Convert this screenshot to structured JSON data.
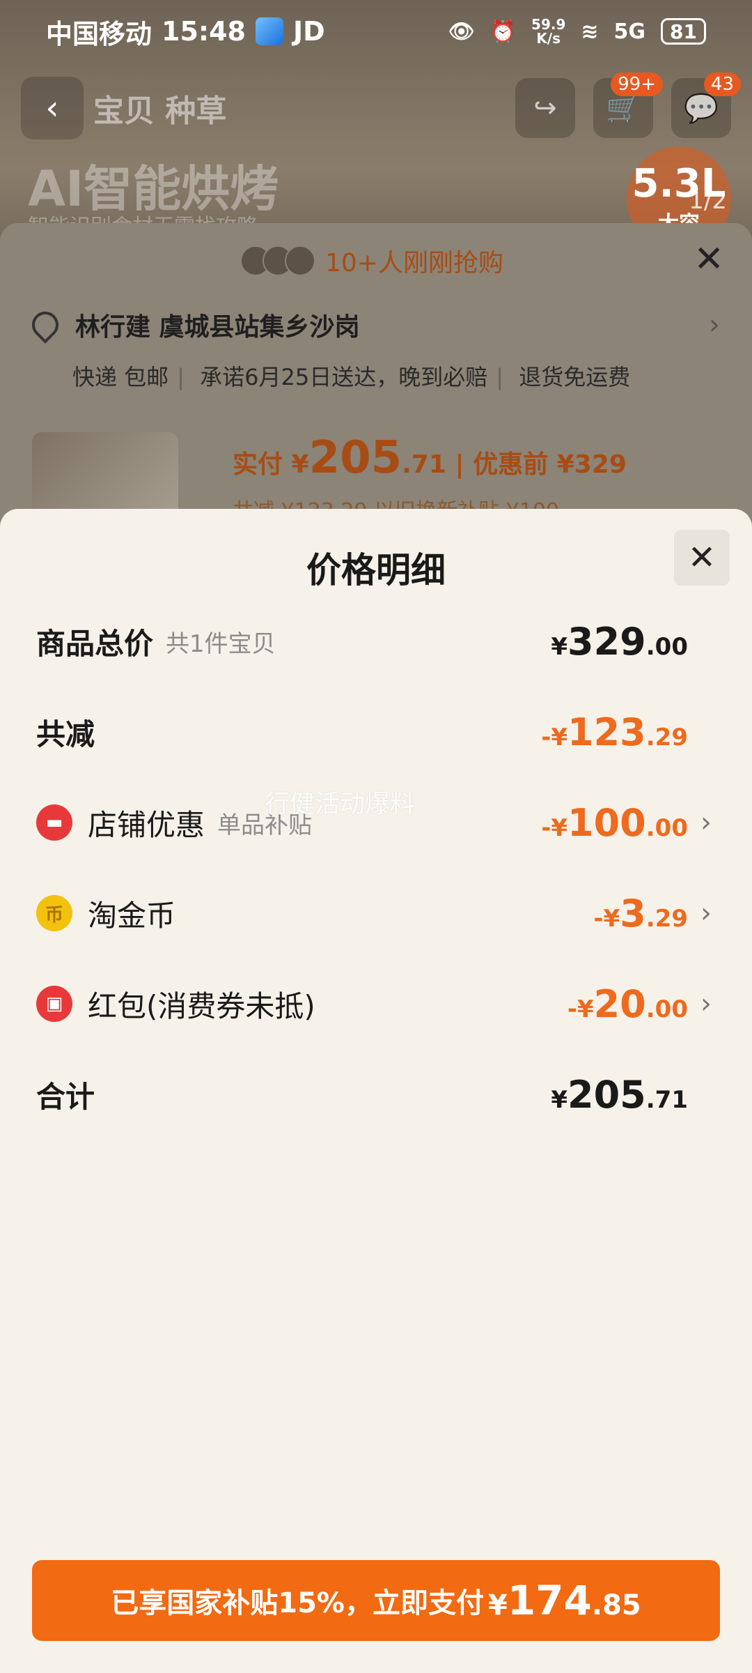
{
  "status_bar": {
    "carrier": "中国移动",
    "time": "15:48",
    "app": "JD",
    "net_speed": "59.9\nK/s",
    "signal": "5G",
    "battery": "81"
  },
  "top_nav": {
    "back_glyph": "‹",
    "brand": "宝贝 种草",
    "cart_badge": "99+",
    "msg_badge": "43"
  },
  "hero": {
    "title": "AI智能烘烤",
    "subtitle": "智能识别食材无需找攻略",
    "capacity": "5.3L",
    "capacity_label": "大容",
    "pager": "1/2"
  },
  "order_sheet": {
    "buyers_text": "10+人刚刚抢购",
    "address": "林行建 虞城县站集乡沙岗",
    "shipping": [
      "快递 包邮",
      "承诺6月25日送达，晚到必赔",
      "退货免运费"
    ],
    "pay_label": "实付 ¥",
    "pay_int": "205",
    "pay_dec": ".71",
    "orig_label": "| 优惠前 ¥329",
    "tags": "共减 ¥123.29    以旧换新补贴 ¥100"
  },
  "detail": {
    "title": "价格明细",
    "rows": [
      {
        "label": "商品总价",
        "sub": "共1件宝贝",
        "sign": "",
        "int": "329",
        "dec": ".00"
      },
      {
        "label": "共减",
        "sub": "",
        "sign": "-",
        "int": "123",
        "dec": ".29"
      },
      {
        "label": "店铺优惠",
        "sub": "单品补贴",
        "sign": "-",
        "int": "100",
        "dec": ".00"
      },
      {
        "label": "淘金币",
        "sub": "",
        "sign": "-",
        "int": "3",
        "dec": ".29"
      },
      {
        "label": "红包(消费券未抵)",
        "sub": "",
        "sign": "-",
        "int": "20",
        "dec": ".00"
      },
      {
        "label": "合计",
        "sub": "",
        "sign": "",
        "int": "205",
        "dec": ".71"
      }
    ],
    "yen": "¥",
    "watermark": "行健活动爆料"
  },
  "pay_button": {
    "label": "已享国家补贴15%，立即支付",
    "yen": "¥",
    "int": "174",
    "dec": ".85"
  },
  "colors": {
    "accent": "#f26a12",
    "discount": "#ed6a1e",
    "sheet_bg": "#f6f2ea"
  }
}
